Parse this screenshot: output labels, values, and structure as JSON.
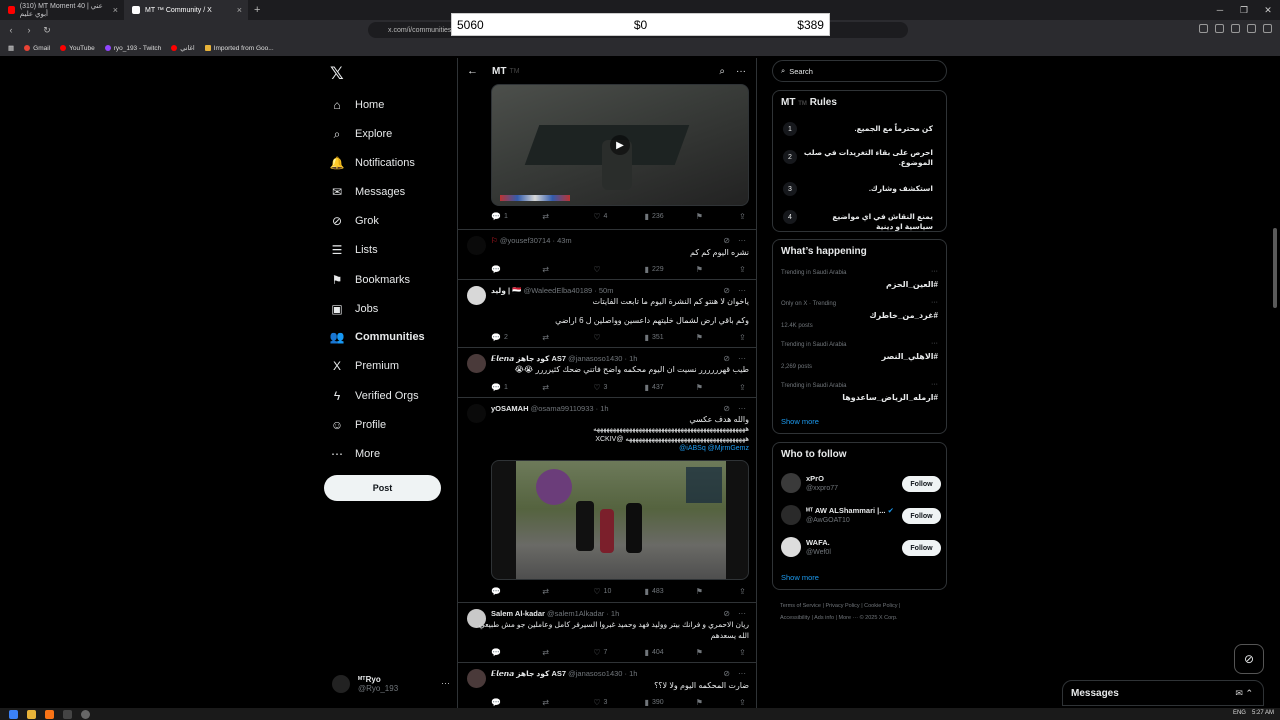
{
  "browser": {
    "tabs": [
      {
        "title": "(310) MT Moment 40 | عني أبوي عليم",
        "active": false,
        "favicon_color": "#ff0000"
      },
      {
        "title": "MT ™ Community / X",
        "active": true,
        "favicon_color": "#ffffff"
      }
    ],
    "url": "x.com/i/communities",
    "bookmarks": [
      "Gmail",
      "YouTube",
      "ryo_193 - Twitch",
      "اغاني",
      "Imported from Goo..."
    ]
  },
  "overlay": {
    "left": "5060",
    "middle": "$0",
    "right": "$389"
  },
  "nav": {
    "items": [
      {
        "label": "Home",
        "icon": "home-icon",
        "glyph": "⌂"
      },
      {
        "label": "Explore",
        "icon": "search-icon",
        "glyph": "⌕"
      },
      {
        "label": "Notifications",
        "icon": "bell-icon",
        "glyph": "🔔"
      },
      {
        "label": "Messages",
        "icon": "mail-icon",
        "glyph": "✉"
      },
      {
        "label": "Grok",
        "icon": "grok-icon",
        "glyph": "⊘"
      },
      {
        "label": "Lists",
        "icon": "list-icon",
        "glyph": "☰"
      },
      {
        "label": "Bookmarks",
        "icon": "bookmark-icon",
        "glyph": "⚑"
      },
      {
        "label": "Jobs",
        "icon": "briefcase-icon",
        "glyph": "▣"
      },
      {
        "label": "Communities",
        "icon": "people-icon",
        "glyph": "👥"
      },
      {
        "label": "Premium",
        "icon": "x-icon",
        "glyph": "X"
      },
      {
        "label": "Verified Orgs",
        "icon": "bolt-icon",
        "glyph": "ϟ"
      },
      {
        "label": "Profile",
        "icon": "person-icon",
        "glyph": "☺"
      },
      {
        "label": "More",
        "icon": "more-icon",
        "glyph": "⋯"
      }
    ],
    "active": "Communities",
    "post_label": "Post",
    "account": {
      "name": "ᴹᵀRyo",
      "handle": "@Ryo_193"
    }
  },
  "community": {
    "title": "MT",
    "tm": "TM"
  },
  "posts": [
    {
      "stats": {
        "replies": "1",
        "reposts": "",
        "likes": "4",
        "views": "236"
      }
    },
    {
      "name": "",
      "handle": "@yousef30714",
      "time": "43m",
      "text": [
        "نشره اليوم كم كم"
      ],
      "stats": {
        "replies": "",
        "reposts": "",
        "likes": "",
        "views": "229"
      }
    },
    {
      "name": "ولید | 🇾🇪",
      "handle": "@WaleedElba40189",
      "time": "50m",
      "text": [
        "ياخوان لا هنتو كم النشرة اليوم ما تابعت الفايتات",
        "وكم باقي ارض لشمال خليتهم داعسين وواصلين ل 6 اراضي"
      ],
      "stats": {
        "replies": "2",
        "reposts": "",
        "likes": "",
        "views": "351"
      }
    },
    {
      "name": "𝙀𝙡𝙚𝙣𝙖 كود جاهز AS7",
      "handle": "@janasoso1430",
      "time": "1h",
      "text": [
        "طيب قهرررررر نسيت ان اليوم محكمه واضح فاتني ضحك كثيرررر 😭😭"
      ],
      "stats": {
        "replies": "1",
        "reposts": "",
        "likes": "3",
        "views": "437"
      }
    },
    {
      "name": "yOSAMAH",
      "handle": "@osama99110933",
      "time": "1h",
      "text": [
        "والله هدف عكسي",
        "هههههههههههههههههههههههههههههههههههههههههههههههه",
        "هههههههههههههههههههههههههههههههههههههه @XCKIV",
        "@iABSq @MjrmGemz"
      ],
      "stats": {
        "replies": "",
        "reposts": "",
        "likes": "10",
        "views": "483"
      }
    },
    {
      "name": "Salem Al-kadar",
      "handle": "@salem1Alkadar",
      "time": "1h",
      "text": [
        "ريان الاحمري و فرانك بيتر ووليد فهد وحميد غبروا السيرفر كامل وعاملين جو مش طبيعي",
        "الله يسعدهم"
      ],
      "stats": {
        "replies": "",
        "reposts": "",
        "likes": "7",
        "views": "404"
      }
    },
    {
      "name": "𝙀𝙡𝙚𝙣𝙖 كود جاهز AS7",
      "handle": "@janasoso1430",
      "time": "1h",
      "text": [
        "ضارت المحكمه اليوم ولا لا؟؟"
      ],
      "stats": {
        "replies": "",
        "reposts": "",
        "likes": "3",
        "views": "390"
      }
    }
  ],
  "search": {
    "placeholder": "Search"
  },
  "rules": {
    "title_prefix": "MT",
    "tm": "TM",
    "title_suffix": "Rules",
    "items": [
      {
        "num": "1",
        "text": "كن محترماً مع الجميع."
      },
      {
        "num": "2",
        "text": "احرص على بقاء التغريدات في صلب الموضوع."
      },
      {
        "num": "3",
        "text": "استكشف وشارك."
      },
      {
        "num": "4",
        "text": "يمنع النقاش في اي مواضيع سياسية او دينية"
      }
    ]
  },
  "whats_happening": {
    "title": "What’s happening",
    "trends": [
      {
        "meta": "Trending in Saudi Arabia",
        "tag": "#العين_الحزم",
        "posts": ""
      },
      {
        "meta": "Only on X · Trending",
        "tag": "#غرد_من_خاطرك",
        "posts": "12.4K posts"
      },
      {
        "meta": "Trending in Saudi Arabia",
        "tag": "#الاهلي_النصر",
        "posts": "2,269 posts"
      },
      {
        "meta": "Trending in Saudi Arabia",
        "tag": "#ارمله_الرياض_ساعدوها",
        "posts": ""
      }
    ],
    "show_more": "Show more"
  },
  "who_to_follow": {
    "title": "Who to follow",
    "accounts": [
      {
        "name": "xPrO",
        "handle": "@xxpro77"
      },
      {
        "name": "ᴹᵀ AW ALShammari |...",
        "handle": "@AwGOAT10"
      },
      {
        "name": "WAFA.",
        "handle": "@Wef0l"
      }
    ],
    "follow_label": "Follow",
    "show_more": "Show more"
  },
  "footer": {
    "line1": "Terms of Service  |  Privacy Policy  |  Cookie Policy  |",
    "line2": "Accessibility  |  Ads info  |  More ···  © 2025 X Corp."
  },
  "messages_dock": {
    "label": "Messages"
  },
  "taskbar": {
    "lang": "ENG",
    "time": "5:27 AM"
  }
}
